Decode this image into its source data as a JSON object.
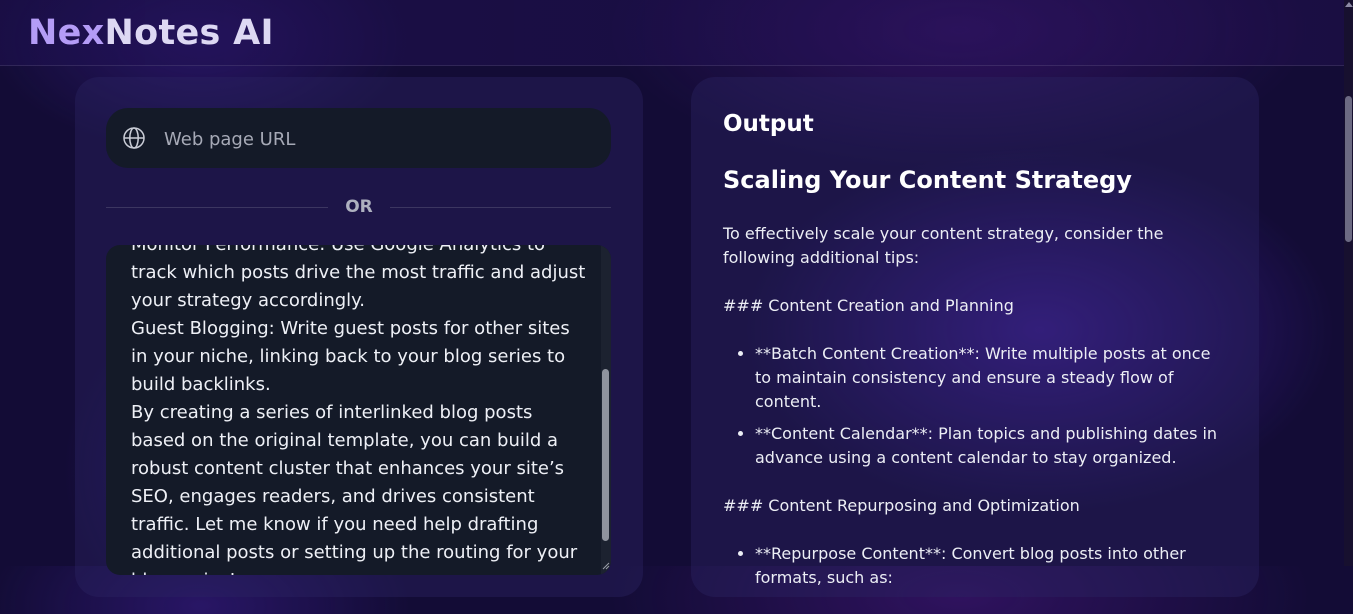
{
  "app": {
    "logo_part1": "Nex",
    "logo_part2": "Notes AI"
  },
  "input": {
    "url_placeholder": "Web page URL",
    "divider_text": "OR",
    "text_lines": [
      "Monitor Performance: Use Google Analytics to track which posts drive the most traffic and adjust your strategy accordingly.",
      "Guest Blogging: Write guest posts for other sites in your niche, linking back to your blog series to build backlinks.",
      "By creating a series of interlinked blog posts based on the original template, you can build a robust content cluster that enhances your site’s SEO, engages readers, and drives consistent traffic. Let me know if you need help drafting additional posts or setting up the routing for your blog series!"
    ]
  },
  "output": {
    "title": "Output",
    "heading": "Scaling Your Content Strategy",
    "intro": "To effectively scale your content strategy, consider the following additional tips:",
    "section1_heading": "### Content Creation and Planning",
    "section1_items": [
      "**Batch Content Creation**: Write multiple posts at once to maintain consistency and ensure a steady flow of content.",
      "**Content Calendar**: Plan topics and publishing dates in advance using a content calendar to stay organized."
    ],
    "section2_heading": "### Content Repurposing and Optimization",
    "section2_items": [
      "**Repurpose Content**: Convert blog posts into other formats, such as:"
    ]
  },
  "icons": {
    "url_icon": "globe-icon"
  },
  "colors": {
    "brand_accent": "#b49cf6",
    "background": "#130c36",
    "input_bg": "#141a28"
  }
}
